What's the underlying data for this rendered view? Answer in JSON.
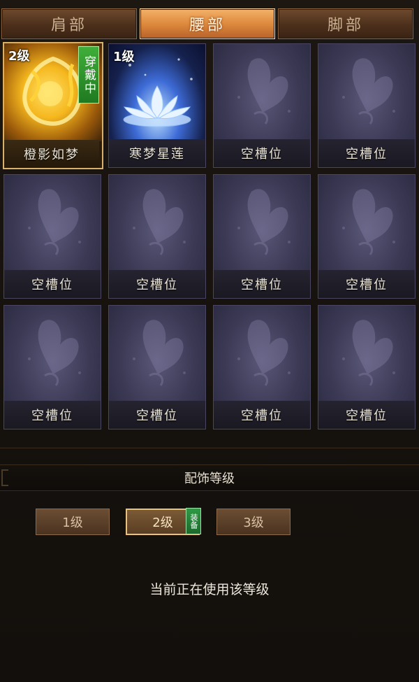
{
  "tabs": [
    {
      "label": "肩部",
      "active": false
    },
    {
      "label": "腰部",
      "active": true
    },
    {
      "label": "脚部",
      "active": false
    }
  ],
  "slots": [
    {
      "label": "橙影如梦",
      "level": "2级",
      "badge": "穿戴中",
      "art": "golden-flame-icon"
    },
    {
      "label": "寒梦星莲",
      "level": "1级",
      "badge": "",
      "art": "lotus-icon"
    },
    {
      "label": "空槽位",
      "art": "butterfly-icon"
    },
    {
      "label": "空槽位",
      "art": "butterfly-icon"
    },
    {
      "label": "空槽位",
      "art": "butterfly-icon"
    },
    {
      "label": "空槽位",
      "art": "butterfly-icon"
    },
    {
      "label": "空槽位",
      "art": "butterfly-icon"
    },
    {
      "label": "空槽位",
      "art": "butterfly-icon"
    },
    {
      "label": "空槽位",
      "art": "butterfly-icon"
    },
    {
      "label": "空槽位",
      "art": "butterfly-icon"
    },
    {
      "label": "空槽位",
      "art": "butterfly-icon"
    },
    {
      "label": "空槽位",
      "art": "butterfly-icon"
    }
  ],
  "section": {
    "title": "配饰等级"
  },
  "levels": [
    {
      "label": "1级",
      "active": false
    },
    {
      "label": "2级",
      "active": true
    },
    {
      "label": "3级",
      "active": false
    }
  ],
  "equip_badge": "装备",
  "status_text": "当前正在使用该等级",
  "colors": {
    "active_tab": "#de8a3d",
    "wearing_badge": "#3fae3a",
    "slot_bg": "#3b3954"
  }
}
